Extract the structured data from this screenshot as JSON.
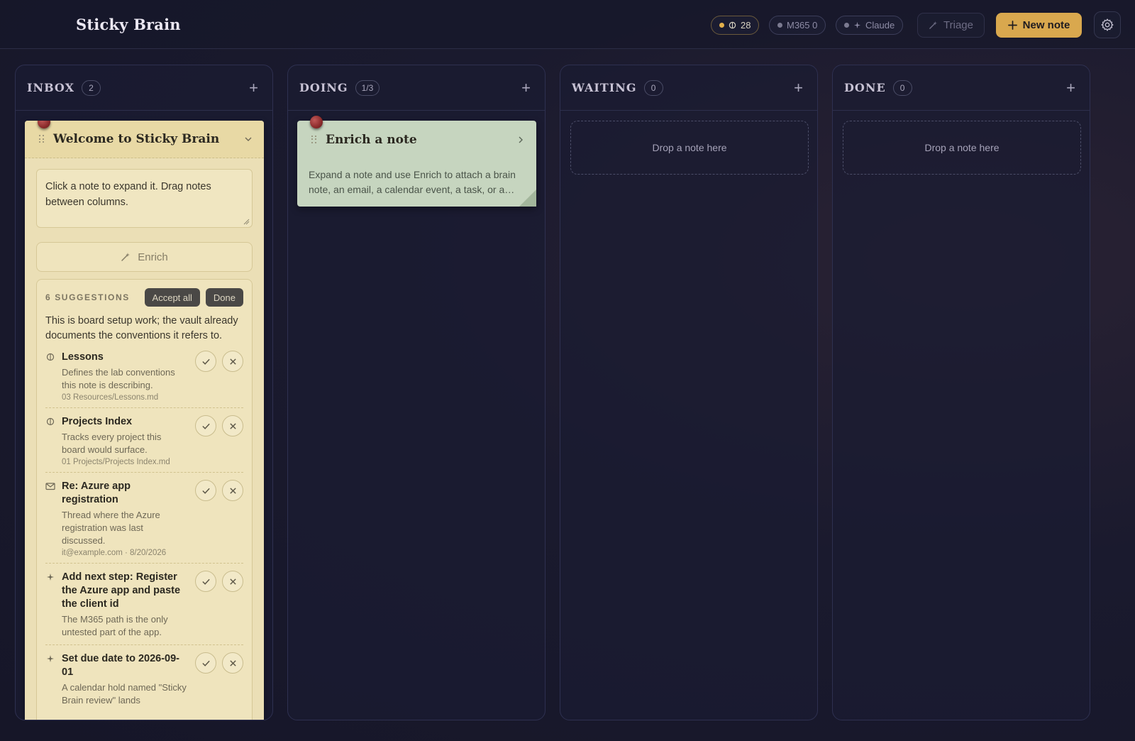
{
  "header": {
    "title": "Sticky Brain",
    "vault_count": "28",
    "m365_label": "M365 0",
    "claude_label": "Claude",
    "triage_label": "Triage",
    "new_note_label": "New note"
  },
  "columns": [
    {
      "title": "INBOX",
      "count": "2"
    },
    {
      "title": "DOING",
      "count": "1/3"
    },
    {
      "title": "WAITING",
      "count": "0",
      "drop_text": "Drop a note here"
    },
    {
      "title": "DONE",
      "count": "0",
      "drop_text": "Drop a note here"
    }
  ],
  "inbox_note": {
    "title": "Welcome to Sticky Brain",
    "body": "Click a note to expand it. Drag notes between columns.",
    "enrich_label": "Enrich",
    "suggestions": {
      "label": "6 SUGGESTIONS",
      "accept_all": "Accept all",
      "done": "Done",
      "summary": "This is board setup work; the vault already documents the conventions it refers to.",
      "items": [
        {
          "icon": "brain-icon",
          "title": "Lessons",
          "desc": "Defines the lab conventions this note is describing.",
          "meta": "03 Resources/Lessons.md"
        },
        {
          "icon": "brain-icon",
          "title": "Projects Index",
          "desc": "Tracks every project this board would surface.",
          "meta": "01 Projects/Projects Index.md"
        },
        {
          "icon": "mail-icon",
          "title": "Re: Azure app registration",
          "desc": "Thread where the Azure registration was last discussed.",
          "meta": "it@example.com · 8/20/2026"
        },
        {
          "icon": "sparkle-icon",
          "title": "Add next step: Register the Azure app and paste the client id",
          "desc": "The M365 path is the only untested part of the app.",
          "meta": ""
        },
        {
          "icon": "sparkle-icon",
          "title": "Set due date to 2026-09-01",
          "desc": "A calendar hold named \"Sticky Brain review\" lands",
          "meta": ""
        }
      ]
    }
  },
  "doing_note": {
    "title": "Enrich a note",
    "desc": "Expand a note and use Enrich to attach a brain note, an email, a calendar event, a task, or a…"
  }
}
